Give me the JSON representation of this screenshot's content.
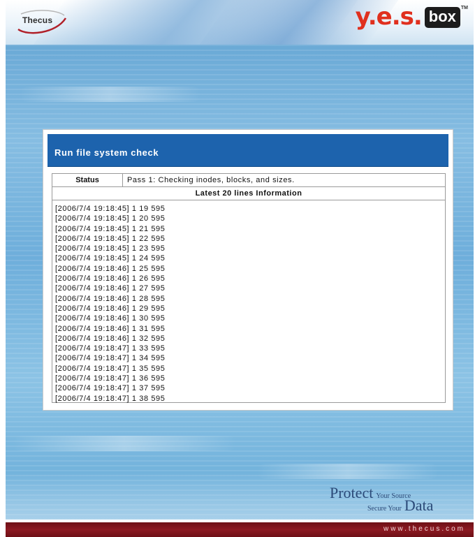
{
  "header": {
    "brand_left": "Thecus",
    "brand_right_yes": "y.e.s.",
    "brand_right_box": "box",
    "brand_tm": "TM"
  },
  "dialog": {
    "title": "Run file system check",
    "status_label": "Status",
    "status_value": "Pass 1: Checking inodes, blocks, and sizes.",
    "latest_label": "Latest 20 lines Information",
    "log_lines": [
      "[2006/7/4 19:18:45] 1 19 595",
      "[2006/7/4 19:18:45] 1 20 595",
      "[2006/7/4 19:18:45] 1 21 595",
      "[2006/7/4 19:18:45] 1 22 595",
      "[2006/7/4 19:18:45] 1 23 595",
      "[2006/7/4 19:18:45] 1 24 595",
      "[2006/7/4 19:18:46] 1 25 595",
      "[2006/7/4 19:18:46] 1 26 595",
      "[2006/7/4 19:18:46] 1 27 595",
      "[2006/7/4 19:18:46] 1 28 595",
      "[2006/7/4 19:18:46] 1 29 595",
      "[2006/7/4 19:18:46] 1 30 595",
      "[2006/7/4 19:18:46] 1 31 595",
      "[2006/7/4 19:18:46] 1 32 595",
      "[2006/7/4 19:18:47] 1 33 595",
      "[2006/7/4 19:18:47] 1 34 595",
      "[2006/7/4 19:18:47] 1 35 595",
      "[2006/7/4 19:18:47] 1 36 595",
      "[2006/7/4 19:18:47] 1 37 595",
      "[2006/7/4 19:18:47] 1 38 595"
    ]
  },
  "footer": {
    "tagline_protect": "Protect",
    "tagline_your_source": "Your Source",
    "tagline_secure_your": "Secure Your",
    "tagline_data": "Data",
    "url": "www.thecus.com"
  },
  "colors": {
    "title_bar": "#1d63ad",
    "brand_red": "#e0301e",
    "footer_bar": "#8d1a22"
  }
}
